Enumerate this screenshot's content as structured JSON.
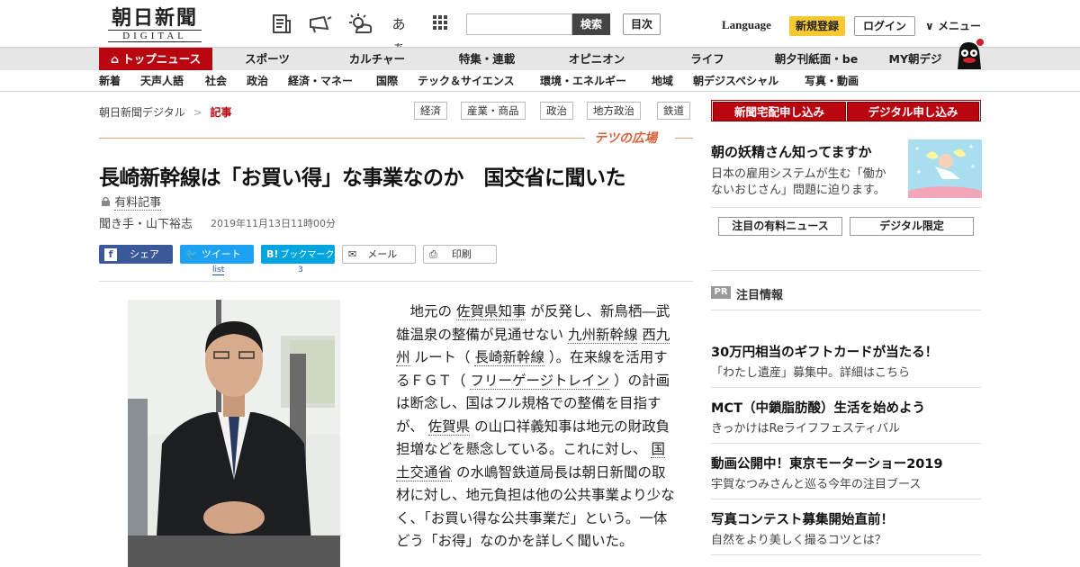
{
  "header": {
    "logo_main": "朝日新聞",
    "logo_sub": "DIGITAL",
    "icon_text": "あぁ",
    "search_placeholder": "",
    "search_button": "検索",
    "toc_button": "目次",
    "language": "Language",
    "register": "新規登録",
    "login": "ログイン",
    "menu": "メニュー"
  },
  "nav_primary": [
    "トップニュース",
    "スポーツ",
    "カルチャー",
    "特集・連載",
    "オピニオン",
    "ライフ",
    "朝夕刊紙面・be",
    "MY朝デジ"
  ],
  "nav_secondary": [
    "新着",
    "天声人語",
    "社会",
    "政治",
    "経済・マネー",
    "国際",
    "テック＆サイエンス",
    "環境・エネルギー",
    "地域",
    "朝デジスペシャル",
    "写真・動画"
  ],
  "breadcrumb": {
    "home": "朝日新聞デジタル",
    "sep": ">",
    "current": "記事"
  },
  "topic_tags": [
    "経済",
    "産業・商品",
    "政治",
    "地方政治",
    "鉄道"
  ],
  "section_logo": "テツの広場",
  "article": {
    "title": "長崎新幹線は「お買い得」な事業なのか　国交省に聞いた",
    "paid_label": "有料記事",
    "byline": "聞き手・山下裕志",
    "date": "2019年11月13日11時00分",
    "share": {
      "facebook": "シェア",
      "twitter": "ツイート",
      "twitter_count": "list",
      "hatena": "ブックマーク",
      "hatena_count": "3",
      "mail": "メール",
      "print": "印刷"
    },
    "body": [
      {
        "t": "　地元の "
      },
      {
        "u": "佐賀県知事"
      },
      {
        "t": " が反発し、新鳥栖―武雄温泉の整備が見通せない "
      },
      {
        "u": "九州新幹線"
      },
      {
        "t": " "
      },
      {
        "u": "西九州"
      },
      {
        "t": " ルート（ "
      },
      {
        "u": "長崎新幹線"
      },
      {
        "t": " ）。在来線を活用するＦＧＴ（ "
      },
      {
        "u": "フリーゲージトレイン"
      },
      {
        "t": " ）の計画は断念し、国はフル規格での整備を目指すが、 "
      },
      {
        "u": "佐賀県"
      },
      {
        "t": " の山口祥義知事は地元の財政負担増などを懸念している。これに対し、 "
      },
      {
        "u": "国土交通省"
      },
      {
        "t": " の水嶋智鉄道局長は朝日新聞の取材に対し、地元負担は他の公共事業より少なく、「お買い得な公共事業だ」という。一体どう「お得」なのかを詳しく聞いた。"
      }
    ]
  },
  "sidebar": {
    "delivery_button": "新聞宅配申し込み",
    "digital_button": "デジタル申し込み",
    "promo_title": "朝の妖精さん知ってますか",
    "promo_text_1": "日本の雇用システムが生む「働か",
    "promo_text_2": "ないおじさん」問題に迫ります。",
    "tab_paid": "注目の有料ニュース",
    "tab_digital": "デジタル限定",
    "pr_badge": "PR",
    "pr_heading": "注目情報",
    "pr_items": [
      {
        "title": "30万円相当のギフトカードが当たる！",
        "sub": "「わたし遺産」募集中。詳細はこちら"
      },
      {
        "title": "MCT（中鎖脂肪酸）生活を始めよう",
        "sub": "きっかけはReライフフェスティバル"
      },
      {
        "title": "動画公開中！東京モーターショー2019",
        "sub": "宇賀なつみさんと巡る今年の注目ブース"
      },
      {
        "title": "写真コンテスト募集開始直前！",
        "sub": "自然をより美しく撮るコツとは？"
      }
    ]
  },
  "colors": {
    "brand_red": "#b8050f",
    "facebook": "#3b5998",
    "twitter": "#1da1f2",
    "hatena": "#00a4de",
    "register_yellow": "#f7c930"
  }
}
